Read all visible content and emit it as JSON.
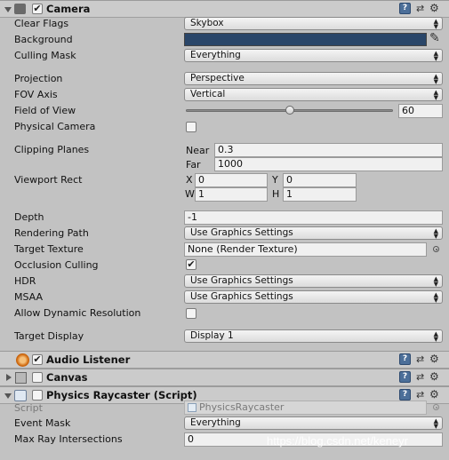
{
  "camera": {
    "title": "Camera",
    "enabled_mark": "✔",
    "properties": {
      "clear_flags": {
        "label": "Clear Flags",
        "value": "Skybox"
      },
      "background": {
        "label": "Background",
        "color": "#2a4669"
      },
      "culling_mask": {
        "label": "Culling Mask",
        "value": "Everything"
      },
      "projection": {
        "label": "Projection",
        "value": "Perspective"
      },
      "fov_axis": {
        "label": "FOV Axis",
        "value": "Vertical"
      },
      "field_of_view": {
        "label": "Field of View",
        "value": "60",
        "slider_fraction": 0.5
      },
      "physical_camera": {
        "label": "Physical Camera",
        "checked": false
      },
      "clipping_planes": {
        "label": "Clipping Planes",
        "near_label": "Near",
        "near": "0.3",
        "far_label": "Far",
        "far": "1000"
      },
      "viewport_rect": {
        "label": "Viewport Rect",
        "x_label": "X",
        "x": "0",
        "y_label": "Y",
        "y": "0",
        "w_label": "W",
        "w": "1",
        "h_label": "H",
        "h": "1"
      },
      "depth": {
        "label": "Depth",
        "value": "-1"
      },
      "rendering_path": {
        "label": "Rendering Path",
        "value": "Use Graphics Settings"
      },
      "target_texture": {
        "label": "Target Texture",
        "value": "None (Render Texture)"
      },
      "occlusion_culling": {
        "label": "Occlusion Culling",
        "checked": true,
        "mark": "✔"
      },
      "hdr": {
        "label": "HDR",
        "value": "Use Graphics Settings"
      },
      "msaa": {
        "label": "MSAA",
        "value": "Use Graphics Settings"
      },
      "allow_dynamic_resolution": {
        "label": "Allow Dynamic Resolution",
        "checked": false
      },
      "target_display": {
        "label": "Target Display",
        "value": "Display 1"
      }
    }
  },
  "audio_listener": {
    "title": "Audio Listener",
    "enabled_mark": "✔"
  },
  "canvas": {
    "title": "Canvas"
  },
  "physics_raycaster": {
    "title": "Physics Raycaster (Script)",
    "script": {
      "label": "Script",
      "value": "PhysicsRaycaster"
    },
    "event_mask": {
      "label": "Event Mask",
      "value": "Everything"
    },
    "max_ray_intersections": {
      "label": "Max Ray Intersections",
      "value": "0"
    }
  },
  "icons": {
    "help": "?",
    "presets": "⇄",
    "settings": "⚙",
    "caret": "▲▼"
  },
  "watermark": "https://blog.csdn.net/keneyr"
}
